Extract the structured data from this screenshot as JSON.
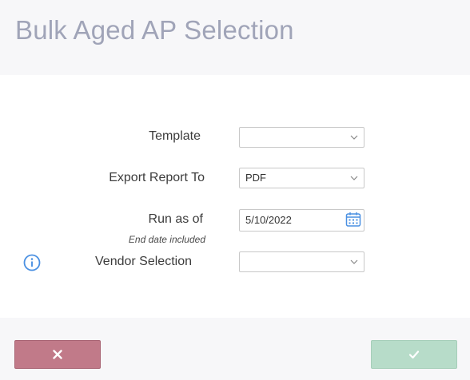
{
  "dialog": {
    "title": "Bulk Aged AP Selection"
  },
  "form": {
    "template": {
      "label": "Template",
      "value": "",
      "icon": "chevron-down-icon"
    },
    "export": {
      "label": "Export Report To",
      "value": "PDF",
      "icon": "chevron-down-icon"
    },
    "run_as_of": {
      "label": "Run as of",
      "sublabel": "End date included",
      "value": "5/10/2022",
      "icon": "calendar-icon"
    },
    "vendor": {
      "label": "Vendor Selection",
      "value": "",
      "icon": "chevron-down-icon",
      "info_icon": "info-icon"
    }
  },
  "footer": {
    "cancel_icon": "close-icon",
    "ok_icon": "check-icon"
  },
  "colors": {
    "header_bg": "#f7f7f9",
    "title": "#a0a4b8",
    "cancel": "#c17a89",
    "ok": "#b7dcc9",
    "accent": "#4a90e2"
  }
}
